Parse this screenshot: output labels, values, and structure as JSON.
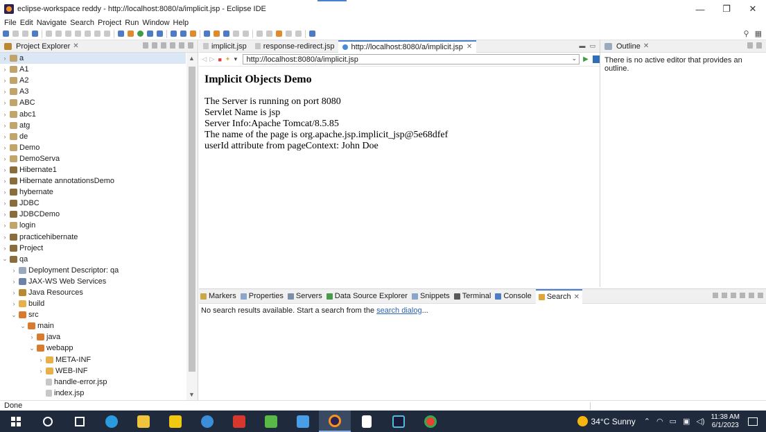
{
  "window": {
    "title": "eclipse-workspace reddy - http://localhost:8080/a/implicit.jsp - Eclipse IDE",
    "minimize": "—",
    "maximize": "❐",
    "close": "✕"
  },
  "menu": [
    "File",
    "Edit",
    "Navigate",
    "Search",
    "Project",
    "Run",
    "Window",
    "Help"
  ],
  "project_explorer": {
    "tab_label": "Project Explorer",
    "items": [
      {
        "label": "a",
        "indent": 0,
        "twisty": "›",
        "icon": "project",
        "selected": true
      },
      {
        "label": "A1",
        "indent": 0,
        "twisty": "›",
        "icon": "project"
      },
      {
        "label": "A2",
        "indent": 0,
        "twisty": "›",
        "icon": "project"
      },
      {
        "label": "A3",
        "indent": 0,
        "twisty": "›",
        "icon": "project"
      },
      {
        "label": "ABC",
        "indent": 0,
        "twisty": "›",
        "icon": "project"
      },
      {
        "label": "abc1",
        "indent": 0,
        "twisty": "›",
        "icon": "project"
      },
      {
        "label": "atg",
        "indent": 0,
        "twisty": "›",
        "icon": "project"
      },
      {
        "label": "de",
        "indent": 0,
        "twisty": "›",
        "icon": "project"
      },
      {
        "label": "Demo",
        "indent": 0,
        "twisty": "›",
        "icon": "project"
      },
      {
        "label": "DemoServa",
        "indent": 0,
        "twisty": "›",
        "icon": "project"
      },
      {
        "label": "Hibernate1",
        "indent": 0,
        "twisty": "›",
        "icon": "project2"
      },
      {
        "label": "Hibernate annotationsDemo",
        "indent": 0,
        "twisty": "›",
        "icon": "project2"
      },
      {
        "label": "hybernate",
        "indent": 0,
        "twisty": "›",
        "icon": "project2"
      },
      {
        "label": "JDBC",
        "indent": 0,
        "twisty": "›",
        "icon": "project2"
      },
      {
        "label": "JDBCDemo",
        "indent": 0,
        "twisty": "›",
        "icon": "project2"
      },
      {
        "label": "login",
        "indent": 0,
        "twisty": "›",
        "icon": "project"
      },
      {
        "label": "practicehibernate",
        "indent": 0,
        "twisty": "›",
        "icon": "project2"
      },
      {
        "label": "Project",
        "indent": 0,
        "twisty": "›",
        "icon": "project2"
      },
      {
        "label": "qa",
        "indent": 0,
        "twisty": "⌄",
        "icon": "project2"
      },
      {
        "label": "Deployment Descriptor: qa",
        "indent": 1,
        "twisty": "›",
        "icon": "dd"
      },
      {
        "label": "JAX-WS Web Services",
        "indent": 1,
        "twisty": "›",
        "icon": "ws"
      },
      {
        "label": "Java Resources",
        "indent": 1,
        "twisty": "›",
        "icon": "jr"
      },
      {
        "label": "build",
        "indent": 1,
        "twisty": "›",
        "icon": "folder"
      },
      {
        "label": "src",
        "indent": 1,
        "twisty": "⌄",
        "icon": "src"
      },
      {
        "label": "main",
        "indent": 2,
        "twisty": "⌄",
        "icon": "src"
      },
      {
        "label": "java",
        "indent": 3,
        "twisty": "›",
        "icon": "src"
      },
      {
        "label": "webapp",
        "indent": 3,
        "twisty": "⌄",
        "icon": "src"
      },
      {
        "label": "META-INF",
        "indent": 4,
        "twisty": "›",
        "icon": "folder"
      },
      {
        "label": "WEB-INF",
        "indent": 4,
        "twisty": "›",
        "icon": "folder"
      },
      {
        "label": "handle-error.jsp",
        "indent": 4,
        "twisty": "",
        "icon": "file"
      },
      {
        "label": "index.jsp",
        "indent": 4,
        "twisty": "",
        "icon": "file"
      }
    ]
  },
  "editor": {
    "tabs": [
      {
        "label": "implicit.jsp",
        "active": false,
        "icon": "file"
      },
      {
        "label": "response-redirect.jsp",
        "active": false,
        "icon": "file"
      },
      {
        "label": "http://localhost:8080/a/implicit.jsp",
        "active": true,
        "icon": "globe"
      }
    ],
    "url": "http://localhost:8080/a/implicit.jsp",
    "page_heading": "Implicit Objects Demo",
    "page_lines": [
      "The Server is running on port 8080",
      "Servlet Name is jsp",
      "Server Info:Apache Tomcat/8.5.85",
      "The name of the page is org.apache.jsp.implicit_jsp@5e68dfef",
      "userId attribute from pageContext: John Doe"
    ]
  },
  "outline": {
    "tab_label": "Outline",
    "message": "There is no active editor that provides an outline."
  },
  "bottom_panel": {
    "tabs": [
      {
        "label": "Markers",
        "color": "#c9a84a"
      },
      {
        "label": "Properties",
        "color": "#8aa6c8"
      },
      {
        "label": "Servers",
        "color": "#7a8fa8"
      },
      {
        "label": "Data Source Explorer",
        "color": "#4b9a4b"
      },
      {
        "label": "Snippets",
        "color": "#8aa6c8"
      },
      {
        "label": "Terminal",
        "color": "#5a5a5a"
      },
      {
        "label": "Console",
        "color": "#4d7cc4"
      },
      {
        "label": "Search",
        "color": "#e0a53a",
        "active": true
      }
    ],
    "search_message_prefix": "No search results available. Start a search from the ",
    "search_link": "search dialog",
    "search_message_suffix": "..."
  },
  "status": "Done",
  "taskbar": {
    "weather": "34°C  Sunny",
    "time": "11:38 AM",
    "date": "6/1/2023"
  },
  "colors": {
    "accent": "#4a7fd0",
    "taskbar": "#1f2b3d",
    "link": "#2a64b6"
  }
}
